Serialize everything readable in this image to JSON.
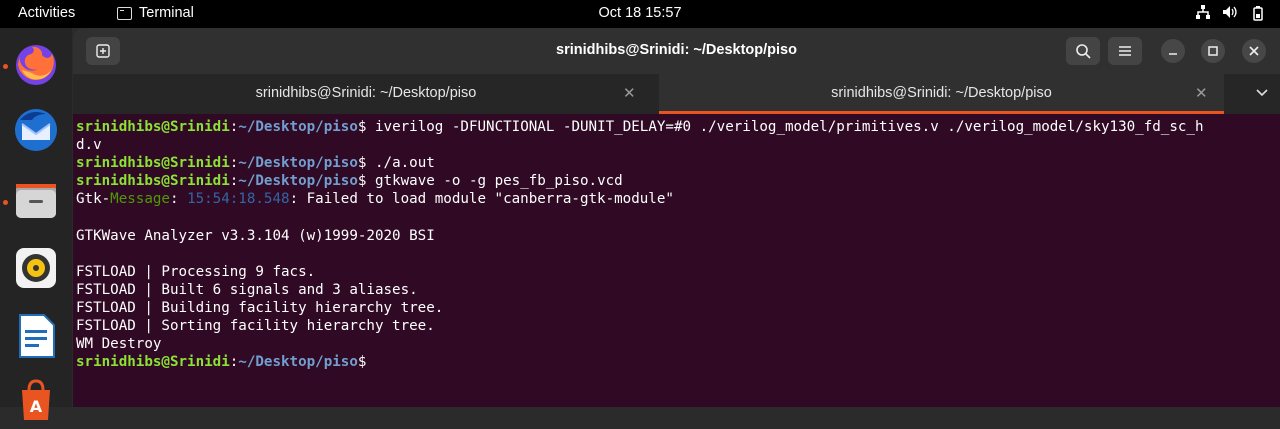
{
  "topbar": {
    "activities": "Activities",
    "app_name": "Terminal",
    "clock": "Oct 18  15:57"
  },
  "window": {
    "title": "srinidhibs@Srinidi: ~/Desktop/piso",
    "tabs": [
      {
        "label": "srinidhibs@Srinidi: ~/Desktop/piso"
      },
      {
        "label": "srinidhibs@Srinidi: ~/Desktop/piso"
      }
    ]
  },
  "terminal": {
    "user": "srinidhibs@Srinidi",
    "path": "~/Desktop/piso",
    "cmd1_a": "iverilog -DFUNCTIONAL -DUNIT_DELAY=#0 ./verilog_model/primitives.v ./verilog_model/sky130_fd_sc_h",
    "cmd1_b": "d.v",
    "cmd2": "./a.out",
    "cmd3": "gtkwave -o -g pes_fb_piso.vcd",
    "gtk_prefix": "Gtk-",
    "gtk_message": "Message",
    "gtk_colon": ": ",
    "gtk_time": "15:54:18.548",
    "gtk_text": ": Failed to load module \"canberra-gtk-module\"",
    "lines": [
      "GTKWave Analyzer v3.3.104 (w)1999-2020 BSI",
      "FSTLOAD | Processing 9 facs.",
      "FSTLOAD | Built 6 signals and 3 aliases.",
      "FSTLOAD | Building facility hierarchy tree.",
      "FSTLOAD | Sorting facility hierarchy tree.",
      "WM Destroy"
    ]
  },
  "colors": {
    "terminal_bg": "#300a24",
    "prompt_user": "#8ae234",
    "prompt_path": "#729fcf",
    "accent": "#e95420"
  }
}
